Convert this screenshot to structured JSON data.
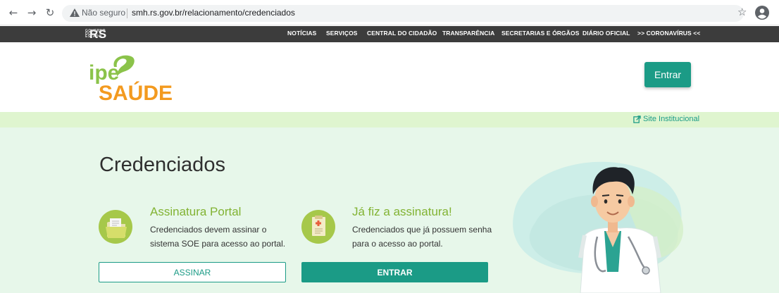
{
  "browser": {
    "security_label": "Não seguro",
    "url": "smh.rs.gov.br/relacionamento/credenciados",
    "back_icon": "arrow-left-icon",
    "forward_icon": "arrow-right-icon",
    "reload_icon": "reload-icon"
  },
  "gov_bar": {
    "logo": "RS",
    "logo_tiny": "GOVERNO DO ESTADO",
    "links": [
      "NOTÍCIAS",
      "SERVIÇOS",
      "CENTRAL DO CIDADÃO",
      "TRANSPARÊNCIA",
      "SECRETARIAS E ÓRGÃOS",
      "DIÁRIO OFICIAL",
      ">> CORONAVÍRUS <<"
    ]
  },
  "header": {
    "logo_text_top": "ipe",
    "logo_text_bottom": "SAÚDE",
    "entrar_label": "Entrar"
  },
  "strip": {
    "site_link": "Site Institucional"
  },
  "main": {
    "title": "Credenciados",
    "cards": [
      {
        "title": "Assinatura Portal",
        "description": "Credenciados devem assinar o sistema SOE para acesso ao portal.",
        "icon": "folder-icon",
        "button": "ASSINAR"
      },
      {
        "title": "Já fiz a assinatura!",
        "description": "Credenciados que já possuem senha para o acesso ao portal.",
        "icon": "medical-document-icon",
        "button": "ENTRAR"
      }
    ]
  },
  "colors": {
    "primary": "#1b9b86",
    "accent_green": "#82b333",
    "strip_bg": "#dff5cf",
    "main_bg": "#e7f7ea",
    "gov_bar": "#3c3c3c",
    "logo_orange": "#f39a1f"
  }
}
